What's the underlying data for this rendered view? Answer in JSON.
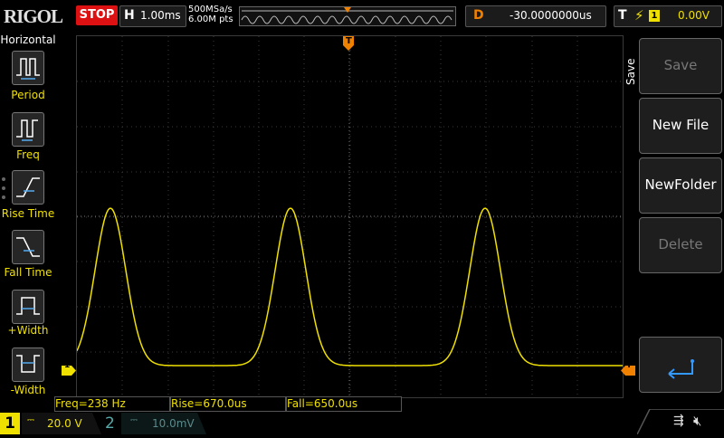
{
  "header": {
    "logo": "RIGOL",
    "run_state": "STOP",
    "horizontal_letter": "H",
    "timebase": "1.00ms",
    "sample_rate": "500MSa/s",
    "memory_depth": "6.00M pts",
    "delay_letter": "D",
    "delay_value": "-30.0000000us",
    "trigger_letter": "T",
    "trigger_source": "1",
    "trigger_level": "0.00V"
  },
  "left_menu": {
    "title": "Horizontal",
    "items": [
      {
        "label": "Period",
        "icon": "period-icon"
      },
      {
        "label": "Freq",
        "icon": "frequency-icon"
      },
      {
        "label": "Rise Time",
        "icon": "rise-time-icon"
      },
      {
        "label": "Fall Time",
        "icon": "fall-time-icon"
      },
      {
        "label": "+Width",
        "icon": "positive-width-icon"
      },
      {
        "label": "-Width",
        "icon": "negative-width-icon"
      }
    ]
  },
  "right_menu": {
    "title": "Save",
    "buttons": [
      {
        "label": "Save",
        "enabled": false
      },
      {
        "label": "New File",
        "enabled": true
      },
      {
        "label": "NewFolder",
        "enabled": true
      },
      {
        "label": "Delete",
        "enabled": false
      }
    ],
    "enter_icon": "enter-arrow-icon"
  },
  "measurements": {
    "freq": "Freq=238 Hz",
    "rise": "Rise=670.0us",
    "fall": "Fall=650.0us"
  },
  "channels": {
    "ch1_number": "1",
    "ch1_scale": "20.0 V",
    "ch2_number": "2",
    "ch2_scale": "10.0mV"
  },
  "markers": {
    "trigger_pos_letter": "T",
    "ch1_ground_label": "1",
    "trigger_level_letter": "T"
  },
  "colors": {
    "ch1": "#f0e000",
    "trigger": "#f08000",
    "stop": "#dd1111",
    "ch2": "#5a8a8a"
  }
}
